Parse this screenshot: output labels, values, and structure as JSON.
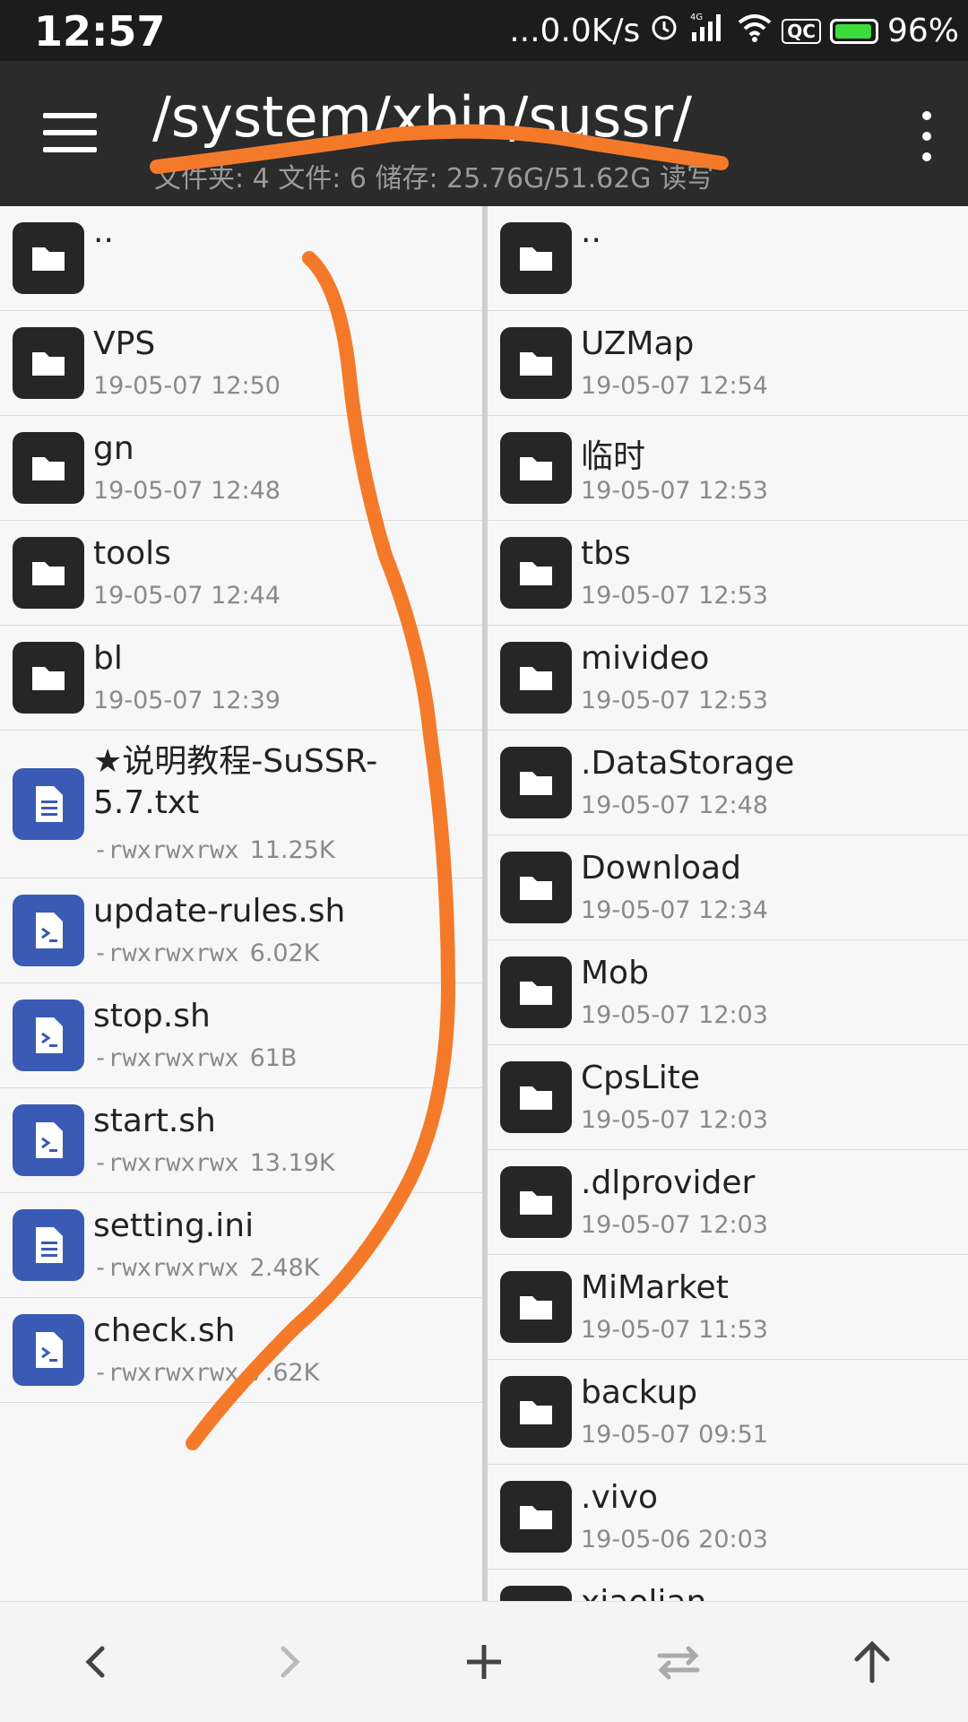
{
  "status_bar": {
    "time": "12:57",
    "net_speed": "...0.0K/s",
    "network_type": "4G",
    "qc_label": "QC",
    "battery": "96%",
    "battery_color": "#3ddc3d"
  },
  "app_bar": {
    "path": "/system/xbin/sussr/",
    "summary": "文件夹: 4  文件: 6  储存: 25.76G/51.62G  读写"
  },
  "left_pane": {
    "items": [
      {
        "name": "..",
        "meta": "",
        "kind": "folder"
      },
      {
        "name": "VPS",
        "meta": "19-05-07 12:50",
        "kind": "folder"
      },
      {
        "name": "gn",
        "meta": "19-05-07 12:48",
        "kind": "folder"
      },
      {
        "name": "tools",
        "meta": "19-05-07 12:44",
        "kind": "folder"
      },
      {
        "name": "bl",
        "meta": "19-05-07 12:39",
        "kind": "folder"
      },
      {
        "name": "★说明教程-SuSSR-5.7.txt",
        "perm": "-rwxrwxrwx",
        "size": "11.25K",
        "kind": "text"
      },
      {
        "name": "update-rules.sh",
        "perm": "-rwxrwxrwx",
        "size": "6.02K",
        "kind": "script"
      },
      {
        "name": "stop.sh",
        "perm": "-rwxrwxrwx",
        "size": "61B",
        "kind": "script"
      },
      {
        "name": "start.sh",
        "perm": "-rwxrwxrwx",
        "size": "13.19K",
        "kind": "script"
      },
      {
        "name": "setting.ini",
        "perm": "-rwxrwxrwx",
        "size": "2.48K",
        "kind": "text"
      },
      {
        "name": "check.sh",
        "perm": "-rwxrwxrwx",
        "size": "7.62K",
        "kind": "script"
      }
    ]
  },
  "right_pane": {
    "items": [
      {
        "name": "..",
        "meta": ""
      },
      {
        "name": "UZMap",
        "meta": "19-05-07 12:54"
      },
      {
        "name": "临时",
        "meta": "19-05-07 12:53"
      },
      {
        "name": "tbs",
        "meta": "19-05-07 12:53"
      },
      {
        "name": "mivideo",
        "meta": "19-05-07 12:53"
      },
      {
        "name": ".DataStorage",
        "meta": "19-05-07 12:48"
      },
      {
        "name": "Download",
        "meta": "19-05-07 12:34"
      },
      {
        "name": "Mob",
        "meta": "19-05-07 12:03"
      },
      {
        "name": "CpsLite",
        "meta": "19-05-07 12:03"
      },
      {
        "name": ".dlprovider",
        "meta": "19-05-07 12:03"
      },
      {
        "name": "MiMarket",
        "meta": "19-05-07 11:53"
      },
      {
        "name": "backup",
        "meta": "19-05-07 09:51"
      },
      {
        "name": ".vivo",
        "meta": "19-05-06 20:03"
      },
      {
        "name": "xiaolian",
        "meta": ""
      }
    ]
  },
  "bottom_bar": {
    "icons": [
      "back-arrow-icon",
      "forward-arrow-icon",
      "add-icon",
      "swap-icon",
      "up-arrow-icon"
    ]
  },
  "colors": {
    "accent_scribble": "#f47a2a",
    "folder_tile": "#262626",
    "file_tile": "#3a5bb5"
  }
}
